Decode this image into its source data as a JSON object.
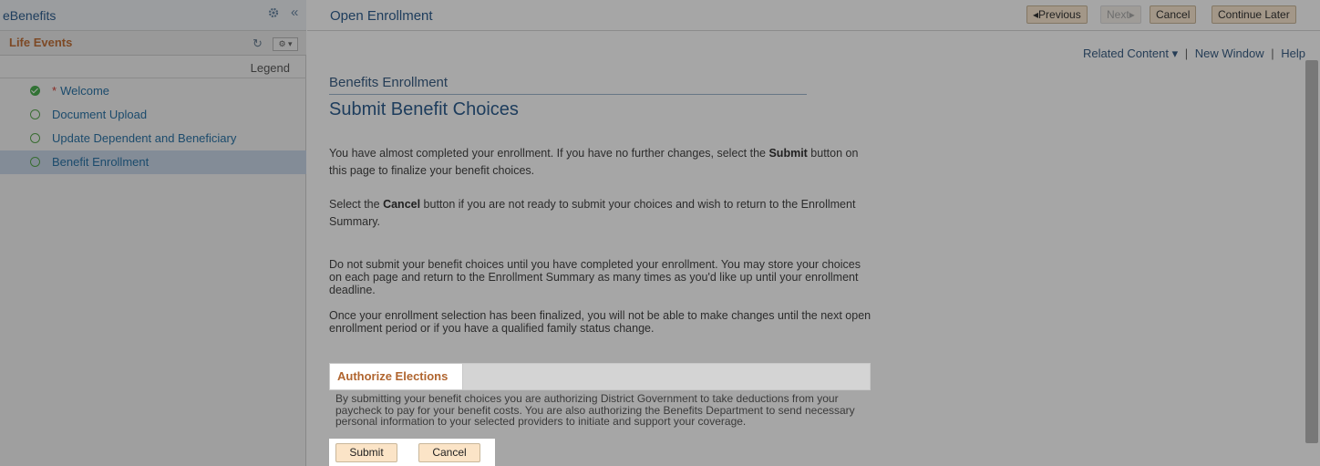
{
  "sidebar": {
    "app_title": "eBenefits",
    "collapse_glyph": "«",
    "section_title": "Life Events",
    "legend_label": "Legend",
    "steps": [
      {
        "label": "Welcome",
        "required_marker": "*",
        "status": "complete"
      },
      {
        "label": "Document Upload",
        "status": "incomplete"
      },
      {
        "label": "Update Dependent and Beneficiary",
        "status": "incomplete"
      },
      {
        "label": "Benefit Enrollment",
        "status": "incomplete",
        "active": true
      }
    ]
  },
  "topbar": {
    "title": "Open Enrollment",
    "previous_label": "Previous",
    "next_label": "Next",
    "cancel_label": "Cancel",
    "continue_later_label": "Continue Later"
  },
  "related_links": {
    "related_content": "Related Content",
    "new_window": "New Window",
    "help": "Help"
  },
  "main": {
    "section_title": "Benefits Enrollment",
    "page_heading": "Submit Benefit Choices",
    "para1_pre": "You have almost completed your enrollment. If you have no further changes, select the ",
    "para1_bold": "Submit",
    "para1_post": " button on this page to finalize your benefit choices.",
    "para2_pre": "Select the ",
    "para2_bold": "Cancel",
    "para2_post": " button if you are not ready to submit your choices and wish to return to the Enrollment Summary.",
    "para3": "Do not submit your benefit choices until you have completed your enrollment. You may store your choices on each page and return to the Enrollment Summary as many times as you'd like up until your enrollment deadline.",
    "para4": "Once your enrollment selection has been finalized, you will not be able to make changes until the next open enrollment period or if you have a qualified family status change."
  },
  "authorize": {
    "title": "Authorize Elections",
    "text": "By submitting your benefit choices you are authorizing District Government to take deductions from your paycheck to pay for your benefit costs. You are also authorizing the Benefits Department to send necessary personal information to your selected providers to initiate and support your coverage.",
    "submit_label": "Submit",
    "cancel_label": "Cancel"
  },
  "colors": {
    "accent_orange": "#c0713a",
    "link_blue": "#2f5f8f",
    "button_fill": "#fbe4c7"
  }
}
